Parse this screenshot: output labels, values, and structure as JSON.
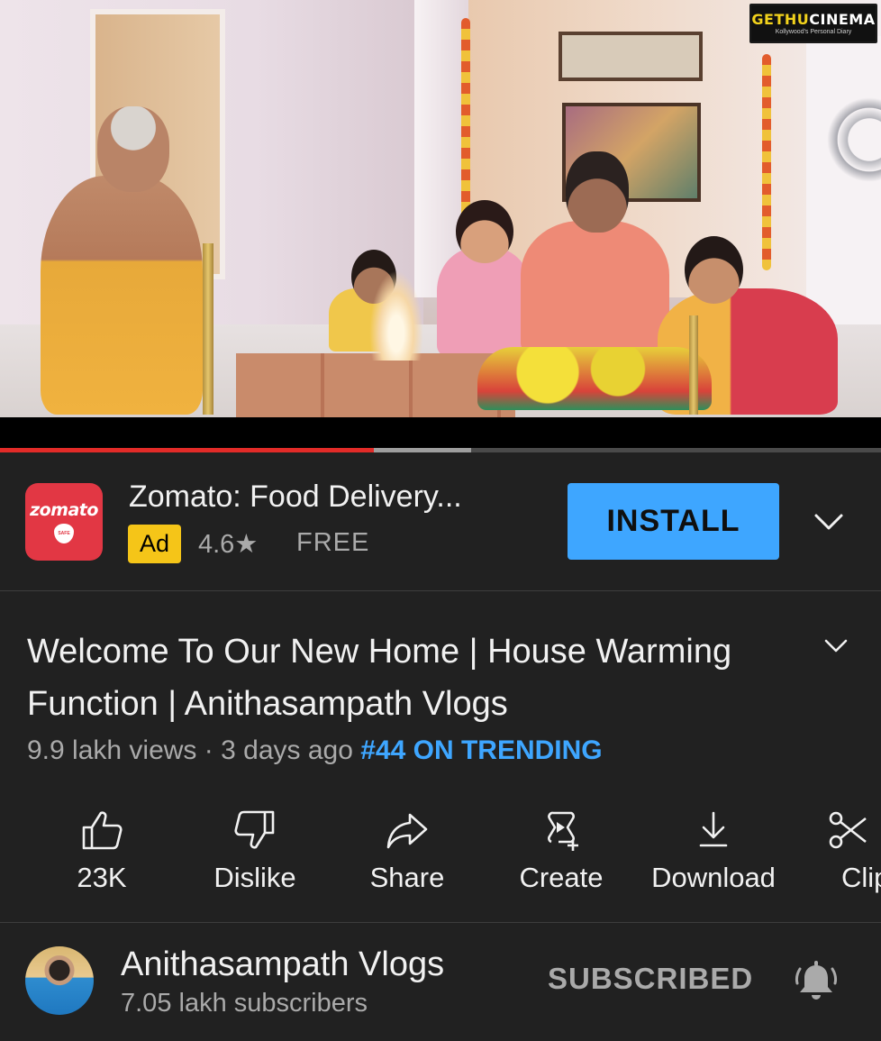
{
  "player": {
    "watermark": {
      "brand_part1": "GETHU",
      "brand_part2": "CINEMA",
      "tagline": "Kollywood's Personal Diary"
    },
    "progress": {
      "played_fraction": 0.424,
      "buffered_fraction": 0.535
    }
  },
  "ad": {
    "app_logo_text": "zomato",
    "app_logo_badge": "SAFE",
    "title": "Zomato: Food Delivery...",
    "tag": "Ad",
    "rating": "4.6★",
    "price": "FREE",
    "install_label": "INSTALL",
    "expand_icon": "chevron-down-icon"
  },
  "video": {
    "title": "Welcome To Our New Home | House Warming Function | Anithasampath Vlogs",
    "views": "9.9 lakh views",
    "age": "3 days ago",
    "trending": "#44 ON TRENDING",
    "expand_icon": "chevron-down-icon"
  },
  "actions": [
    {
      "label": "23K",
      "icon": "thumbs-up-icon"
    },
    {
      "label": "Dislike",
      "icon": "thumbs-down-icon"
    },
    {
      "label": "Share",
      "icon": "share-icon"
    },
    {
      "label": "Create",
      "icon": "create-icon"
    },
    {
      "label": "Download",
      "icon": "download-icon"
    },
    {
      "label": "Clip",
      "icon": "scissors-icon"
    }
  ],
  "channel": {
    "name": "Anithasampath Vlogs",
    "subscribers": "7.05 lakh subscribers",
    "subscribe_state": "SUBSCRIBED",
    "notify_icon": "bell-icon"
  },
  "colors": {
    "background": "#212121",
    "accent_blue": "#3ea6ff",
    "progress_red": "#e22b28",
    "ad_badge_yellow": "#f5c518",
    "zomato_red": "#e23744",
    "secondary_text": "#aaaaaa"
  }
}
